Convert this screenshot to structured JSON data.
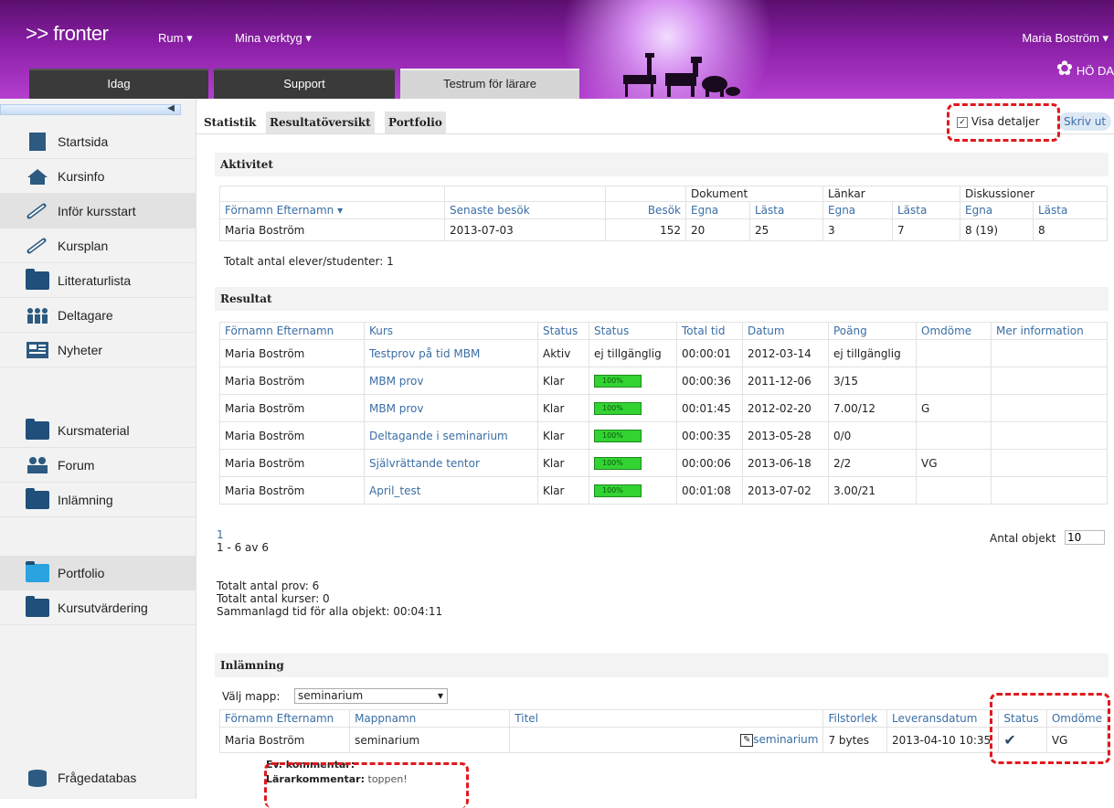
{
  "header": {
    "logo": ">> fronter",
    "menu_rum": "Rum",
    "menu_tools": "Mina verktyg",
    "user": "Maria Boström",
    "brand": "HÖ DA"
  },
  "tabs": [
    "Idag",
    "Support",
    "Testrum för lärare"
  ],
  "sidebar": {
    "items": [
      "Startsida",
      "Kursinfo",
      "Inför kursstart",
      "Kursplan",
      "Litteraturlista",
      "Deltagare",
      "Nyheter",
      "Kursmaterial",
      "Forum",
      "Inlämning",
      "Portfolio",
      "Kursutvärdering",
      "Frågedatabas"
    ]
  },
  "subtabs": [
    "Statistik",
    "Resultatöversikt",
    "Portfolio"
  ],
  "toolbar": {
    "show_details": "Visa detaljer",
    "print": "Skriv ut"
  },
  "activity": {
    "title": "Aktivitet",
    "group_headers": [
      "Dokument",
      "Länkar",
      "Diskussioner"
    ],
    "col_name": "Förnamn  Efternamn",
    "col_last": "Senaste besök",
    "col_visits": "Besök",
    "sub": [
      "Egna",
      "Lästa",
      "Egna",
      "Lästa",
      "Egna",
      "Lästa"
    ],
    "row": [
      "Maria Boström",
      "2013-07-03",
      "152",
      "20",
      "25",
      "3",
      "7",
      "8 (19)",
      "8"
    ],
    "total": "Totalt antal elever/studenter: 1"
  },
  "results": {
    "title": "Resultat",
    "headers": [
      "Förnamn  Efternamn",
      "Kurs",
      "Status",
      "Status",
      "Total tid",
      "Datum",
      "Poäng",
      "Omdöme",
      "Mer information"
    ],
    "rows": [
      [
        "Maria Boström",
        "Testprov på tid MBM",
        "Aktiv",
        "ej tillgänglig",
        "00:00:01",
        "2012-03-14",
        "ej tillgänglig",
        ""
      ],
      [
        "Maria Boström",
        "MBM prov",
        "Klar",
        "100%",
        "00:00:36",
        "2011-12-06",
        "3/15",
        ""
      ],
      [
        "Maria Boström",
        "MBM prov",
        "Klar",
        "100%",
        "00:01:45",
        "2012-02-20",
        "7.00/12",
        "G"
      ],
      [
        "Maria Boström",
        "Deltagande i seminarium",
        "Klar",
        "100%",
        "00:00:35",
        "2013-05-28",
        "0/0",
        ""
      ],
      [
        "Maria Boström",
        "Självrättande tentor",
        "Klar",
        "100%",
        "00:00:06",
        "2013-06-18",
        "2/2",
        "VG"
      ],
      [
        "Maria Boström",
        "April_test",
        "Klar",
        "100%",
        "00:01:08",
        "2013-07-02",
        "3.00/21",
        ""
      ]
    ],
    "page": "1",
    "range": "1 - 6 av 6",
    "per_page_label": "Antal objekt",
    "per_page": "10",
    "summary": [
      "Totalt antal prov: 6",
      "Totalt antal kurser: 0",
      "Sammanlagd tid för alla objekt: 00:04:11"
    ]
  },
  "submission": {
    "title": "Inlämning",
    "folder_label": "Välj mapp:",
    "folder": "seminarium",
    "headers": [
      "Förnamn  Efternamn",
      "Mappnamn",
      "Titel",
      "Filstorlek",
      "Leveransdatum",
      "Status",
      "Omdöme"
    ],
    "row": [
      "Maria Boström",
      "seminarium",
      "seminarium",
      "7 bytes",
      "2013-04-10 10:35",
      "✔",
      "VG"
    ],
    "comment_label": "Ev. kommentar:",
    "teacher_label": "Lärarkommentar:",
    "teacher_comment": "toppen!"
  }
}
